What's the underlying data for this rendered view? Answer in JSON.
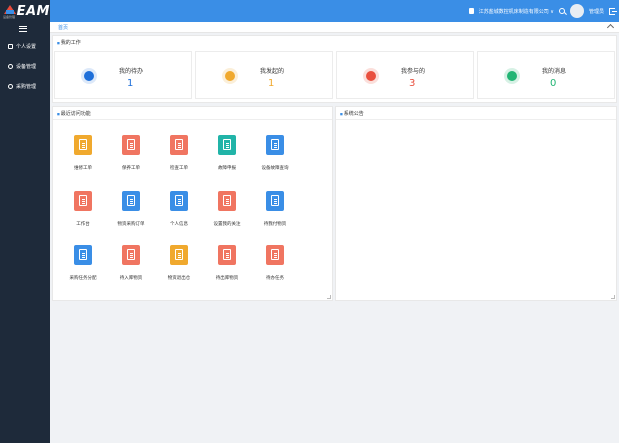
{
  "app": {
    "logo_text": "EAM",
    "logo_sub": "设备管理"
  },
  "header": {
    "org_name": "江苏盐城数控机床制造有限公司 ∨",
    "user_name": "管理员"
  },
  "sidebar": {
    "items": [
      {
        "label": "个人设置",
        "icon": "grid-icon"
      },
      {
        "label": "设备管理",
        "icon": "gear-icon"
      },
      {
        "label": "采购管理",
        "icon": "cart-icon"
      }
    ]
  },
  "breadcrumb": "首页",
  "my_work": {
    "title": "我的工作",
    "cards": [
      {
        "label": "我的待办",
        "count": "1",
        "color": "#1e6fd9",
        "count_color": "#1e6fd9",
        "bg": "#dde9f9"
      },
      {
        "label": "我发起的",
        "count": "1",
        "color": "#f0a92e",
        "count_color": "#f0a92e",
        "bg": "#fbefd9"
      },
      {
        "label": "我参与的",
        "count": "3",
        "color": "#e9503f",
        "count_color": "#e9503f",
        "bg": "#fbdfdb"
      },
      {
        "label": "我的消息",
        "count": "0",
        "color": "#22b574",
        "count_color": "#22b574",
        "bg": "#d7f1e5"
      }
    ]
  },
  "recent_functions": {
    "title": "最近访问功能",
    "items": [
      {
        "label": "维修工单",
        "color": "#f0a92e"
      },
      {
        "label": "保养工单",
        "color": "#f07561"
      },
      {
        "label": "检查工单",
        "color": "#f07561"
      },
      {
        "label": "故障申报",
        "color": "#21b4a8"
      },
      {
        "label": "设备故障查询",
        "color": "#3a8ee6"
      },
      {
        "label": "工作台",
        "color": "#f07561"
      },
      {
        "label": "物资采购订单",
        "color": "#3a8ee6"
      },
      {
        "label": "个人信息",
        "color": "#3a8ee6"
      },
      {
        "label": "设置我的关注",
        "color": "#f07561"
      },
      {
        "label": "待我付物资",
        "color": "#3a8ee6"
      },
      {
        "label": "采购任务分配",
        "color": "#3a8ee6"
      },
      {
        "label": "待入库物资",
        "color": "#f07561"
      },
      {
        "label": "物资退出仓",
        "color": "#f0a92e"
      },
      {
        "label": "待出库物资",
        "color": "#f07561"
      },
      {
        "label": "待办任务",
        "color": "#f07561"
      }
    ]
  },
  "announcements": {
    "title": "系统公告"
  }
}
